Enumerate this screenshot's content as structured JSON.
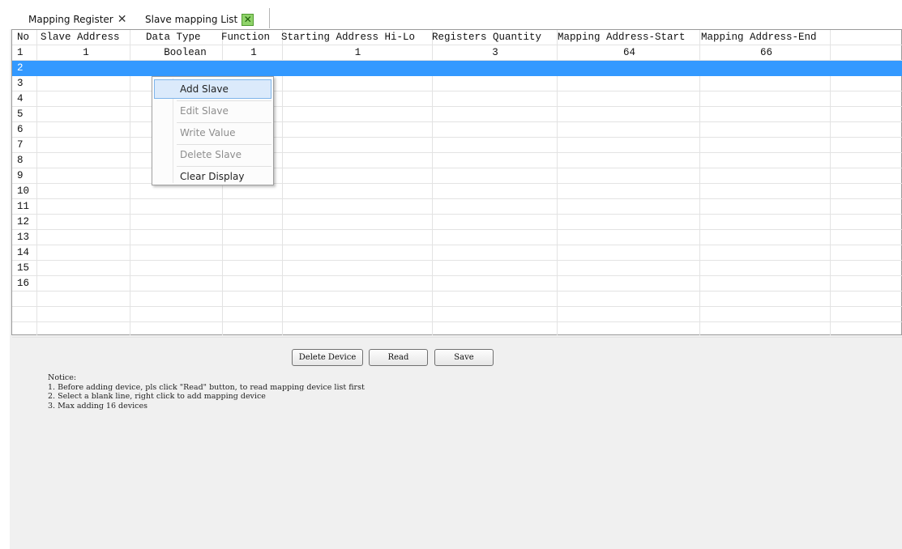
{
  "tabs": [
    {
      "label": "Mapping Register",
      "close_icon": "close-x-icon"
    },
    {
      "label": "Slave mapping List",
      "close_icon": "green-close-icon"
    }
  ],
  "table": {
    "columns": [
      "No",
      "Slave Address",
      "Data Type",
      "Function",
      "Starting Address Hi-Lo",
      "Registers Quantity",
      "Mapping Address-Start",
      "Mapping Address-End"
    ],
    "rows": [
      [
        "1",
        "1",
        "Boolean",
        "1",
        "1",
        "3",
        "64",
        "66"
      ],
      [
        "2",
        "",
        "",
        "",
        "",
        "",
        "",
        ""
      ],
      [
        "3",
        "",
        "",
        "",
        "",
        "",
        "",
        ""
      ],
      [
        "4",
        "",
        "",
        "",
        "",
        "",
        "",
        ""
      ],
      [
        "5",
        "",
        "",
        "",
        "",
        "",
        "",
        ""
      ],
      [
        "6",
        "",
        "",
        "",
        "",
        "",
        "",
        ""
      ],
      [
        "7",
        "",
        "",
        "",
        "",
        "",
        "",
        ""
      ],
      [
        "8",
        "",
        "",
        "",
        "",
        "",
        "",
        ""
      ],
      [
        "9",
        "",
        "",
        "",
        "",
        "",
        "",
        ""
      ],
      [
        "10",
        "",
        "",
        "",
        "",
        "",
        "",
        ""
      ],
      [
        "11",
        "",
        "",
        "",
        "",
        "",
        "",
        ""
      ],
      [
        "12",
        "",
        "",
        "",
        "",
        "",
        "",
        ""
      ],
      [
        "13",
        "",
        "",
        "",
        "",
        "",
        "",
        ""
      ],
      [
        "14",
        "",
        "",
        "",
        "",
        "",
        "",
        ""
      ],
      [
        "15",
        "",
        "",
        "",
        "",
        "",
        "",
        ""
      ],
      [
        "16",
        "",
        "",
        "",
        "",
        "",
        "",
        ""
      ]
    ],
    "selected_row": "2",
    "selection_color": "#3399ff"
  },
  "context_menu": {
    "items": [
      {
        "label": "Add Slave",
        "enabled": true,
        "highlighted": true
      },
      {
        "label": "Edit Slave",
        "enabled": false
      },
      {
        "label": "Write Value",
        "enabled": false
      },
      {
        "label": "Delete Slave",
        "enabled": false
      },
      {
        "label": "Clear Display",
        "enabled": true
      }
    ]
  },
  "buttons": {
    "delete_device": "Delete Device",
    "read": "Read",
    "save": "Save"
  },
  "notice": {
    "title": "Notice:",
    "lines": [
      "1. Before adding device, pls click \"Read\" button, to read mapping device list first",
      "2. Select a blank line, right click to add mapping device",
      "3. Max adding 16 devices"
    ]
  }
}
